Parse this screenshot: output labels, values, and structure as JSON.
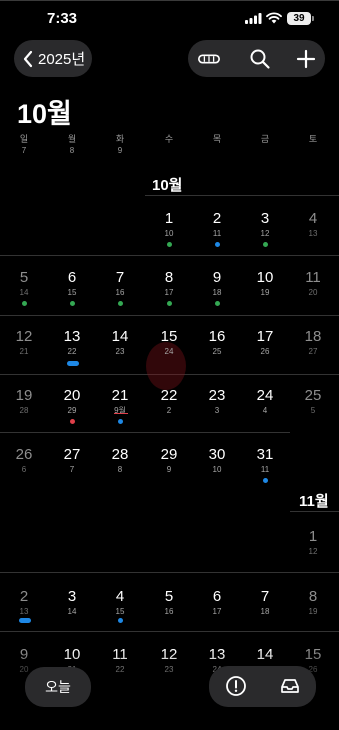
{
  "status_bar": {
    "time": "7:33",
    "battery": "39"
  },
  "header": {
    "back_label": "2025년",
    "month_title": "10월"
  },
  "weekdays": [
    "일",
    "월",
    "화",
    "수",
    "목",
    "금",
    "토"
  ],
  "top_dates": [
    "7",
    "8",
    "9"
  ],
  "month_labels": {
    "october": "10월",
    "november": "11월"
  },
  "weeks": [
    {
      "row": 0,
      "days": [
        {
          "col": 3,
          "n": "1",
          "s": "10"
        },
        {
          "col": 4,
          "n": "2",
          "s": "11"
        },
        {
          "col": 5,
          "n": "3",
          "s": "12"
        },
        {
          "col": 6,
          "n": "4",
          "s": "13"
        }
      ]
    },
    {
      "row": 1,
      "days": [
        {
          "col": 0,
          "n": "5",
          "s": "14"
        },
        {
          "col": 1,
          "n": "6",
          "s": "15"
        },
        {
          "col": 2,
          "n": "7",
          "s": "16"
        },
        {
          "col": 3,
          "n": "8",
          "s": "17"
        },
        {
          "col": 4,
          "n": "9",
          "s": "18"
        },
        {
          "col": 5,
          "n": "10",
          "s": "19"
        },
        {
          "col": 6,
          "n": "11",
          "s": "20"
        }
      ]
    },
    {
      "row": 2,
      "days": [
        {
          "col": 0,
          "n": "12",
          "s": "21"
        },
        {
          "col": 1,
          "n": "13",
          "s": "22"
        },
        {
          "col": 2,
          "n": "14",
          "s": "23"
        },
        {
          "col": 3,
          "n": "15",
          "s": "24"
        },
        {
          "col": 4,
          "n": "16",
          "s": "25"
        },
        {
          "col": 5,
          "n": "17",
          "s": "26"
        },
        {
          "col": 6,
          "n": "18",
          "s": "27"
        }
      ]
    },
    {
      "row": 3,
      "days": [
        {
          "col": 0,
          "n": "19",
          "s": "28"
        },
        {
          "col": 1,
          "n": "20",
          "s": "29"
        },
        {
          "col": 2,
          "n": "21",
          "s": "9월"
        },
        {
          "col": 3,
          "n": "22",
          "s": "2"
        },
        {
          "col": 4,
          "n": "23",
          "s": "3"
        },
        {
          "col": 5,
          "n": "24",
          "s": "4"
        },
        {
          "col": 6,
          "n": "25",
          "s": "5"
        }
      ]
    },
    {
      "row": 4,
      "days": [
        {
          "col": 0,
          "n": "26",
          "s": "6"
        },
        {
          "col": 1,
          "n": "27",
          "s": "7"
        },
        {
          "col": 2,
          "n": "28",
          "s": "8"
        },
        {
          "col": 3,
          "n": "29",
          "s": "9"
        },
        {
          "col": 4,
          "n": "30",
          "s": "10"
        },
        {
          "col": 5,
          "n": "31",
          "s": "11"
        }
      ]
    },
    {
      "row": 5,
      "days": [
        {
          "col": 6,
          "n": "1",
          "s": "12"
        }
      ]
    },
    {
      "row": 6,
      "days": [
        {
          "col": 0,
          "n": "2",
          "s": "13"
        },
        {
          "col": 1,
          "n": "3",
          "s": "14"
        },
        {
          "col": 2,
          "n": "4",
          "s": "15"
        },
        {
          "col": 3,
          "n": "5",
          "s": "16"
        },
        {
          "col": 4,
          "n": "6",
          "s": "17"
        },
        {
          "col": 5,
          "n": "7",
          "s": "18"
        },
        {
          "col": 6,
          "n": "8",
          "s": "19"
        }
      ]
    },
    {
      "row": 7,
      "days": [
        {
          "col": 0,
          "n": "9",
          "s": "20"
        },
        {
          "col": 1,
          "n": "10",
          "s": "21"
        },
        {
          "col": 2,
          "n": "11",
          "s": "22"
        },
        {
          "col": 3,
          "n": "12",
          "s": "23"
        },
        {
          "col": 4,
          "n": "13",
          "s": "24"
        },
        {
          "col": 5,
          "n": "14",
          "s": "25"
        },
        {
          "col": 6,
          "n": "15",
          "s": "26"
        }
      ]
    }
  ],
  "bottom_bar": {
    "today_label": "오늘"
  },
  "colors": {
    "event_green": "#34a853",
    "event_blue": "#1e88e5",
    "event_red": "#e0404a"
  }
}
